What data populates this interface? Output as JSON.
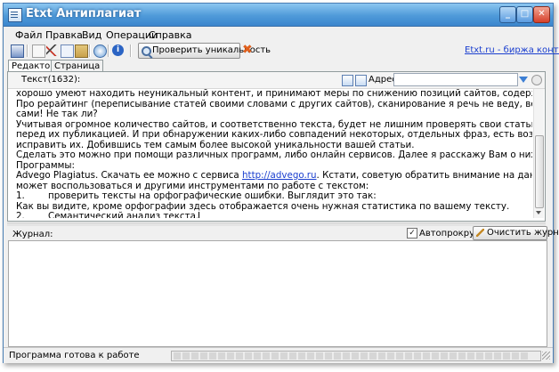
{
  "window": {
    "title": "Etxt Антиплагиат",
    "controls": {
      "minimize": "_",
      "maximize": "□",
      "close": "✕"
    }
  },
  "menu": {
    "items": [
      "Файл",
      "Правка",
      "Вид",
      "Операции",
      "Справка"
    ]
  },
  "toolbar": {
    "check_button_label": "Проверить уникальность",
    "link_text": "Etxt.ru - биржа контента",
    "stop_glyph": "✖"
  },
  "tabs": [
    "Редактор",
    "Страница"
  ],
  "editor": {
    "text_count_label": "Текст(1632):",
    "address_label": "Адрес:",
    "address_value": "",
    "lines": [
      "хорошо умеют находить неуникальный контент, и принимают меры по снижению позиций сайтов, содержащих такие тексты.",
      "Про рерайтинг (переписывание статей своими словами с других сайтов), сканирование я речь не веду, ведь статьи мы пишем",
      "сами! Не так ли?",
      "Учитывая огромное количество сайтов, и соответственно текста, будет не лишним проверять свои статьи на уникальность,",
      "перед их публикацией. И при обнаружении каких-либо совпадений некоторых, отдельных фраз, есть возможность заменить и",
      "исправить их. Добившись тем самым более высокой уникальности вашей статьи.",
      "Сделать это можно при помощи различных программ, либо онлайн сервисов. Далее я расскажу Вам о них.",
      "Программы:",
      "Advego Plagiatus. Скачать ее можно с сервиса ",
      "может воспользоваться и другими инструментами по работе с текстом:",
      "1.        проверить тексты на орфографические ошибки. Выглядит это так:",
      "Как вы видите, кроме орфографии здесь отображается очень нужная статистика по вашему тексту.",
      "2.        Семантический анализ текста."
    ],
    "link_line": {
      "link": "http://advego.ru",
      "after": ". Кстати, советую обратить внимание на данный сервис. В нем вы"
    }
  },
  "journal": {
    "label": "Журнал:",
    "autoscroll_label": "Автопрокрутка",
    "autoscroll_checked": true,
    "check_mark": "✓",
    "clear_button_label": "Очистить журнал"
  },
  "status": {
    "text": "Программа готова к работе"
  }
}
